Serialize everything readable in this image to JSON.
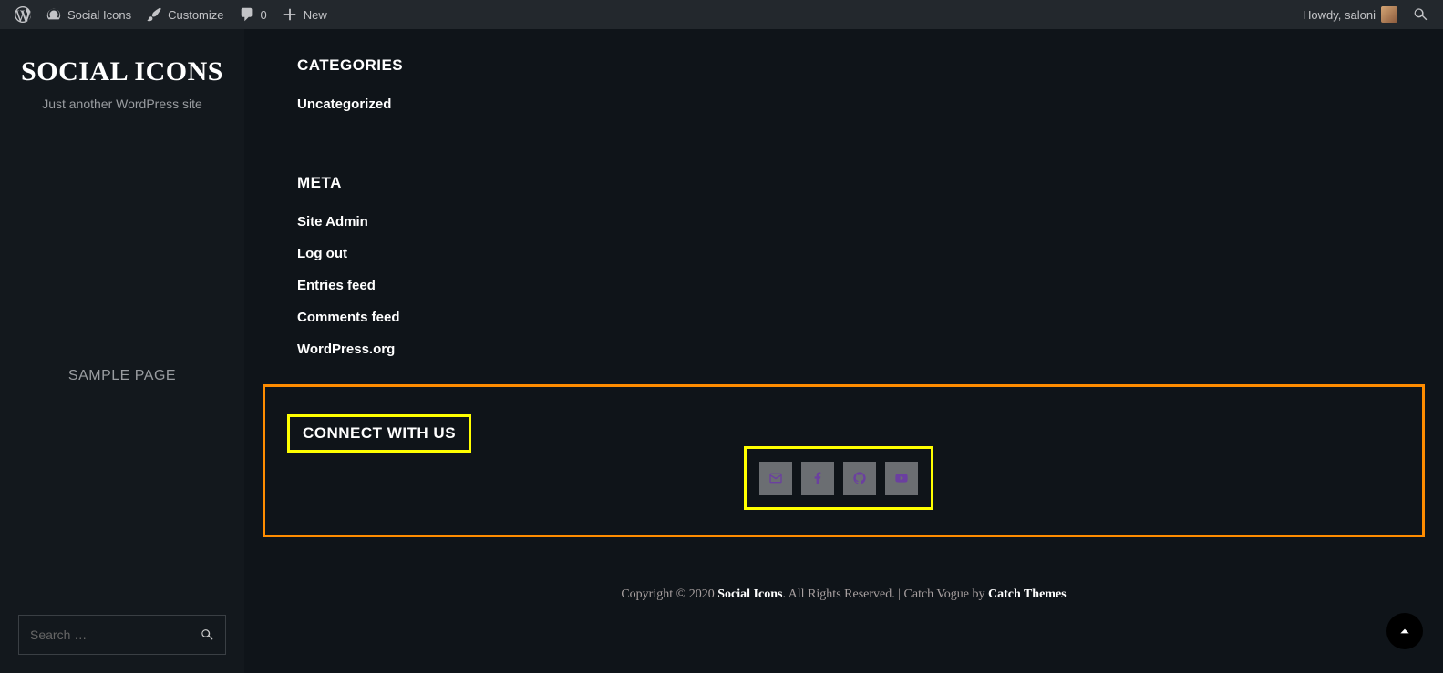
{
  "admin": {
    "siteName": "Social Icons",
    "customize": "Customize",
    "commentCount": "0",
    "new": "New",
    "howdy": "Howdy, saloni"
  },
  "sidebar": {
    "title": "SOCIAL ICONS",
    "tagline": "Just another WordPress site",
    "nav": "SAMPLE PAGE",
    "searchPlaceholder": "Search …"
  },
  "widgets": {
    "categories": {
      "title": "CATEGORIES",
      "items": [
        "Uncategorized"
      ]
    },
    "meta": {
      "title": "META",
      "items": [
        "Site Admin",
        "Log out",
        "Entries feed",
        "Comments feed",
        "WordPress.org"
      ]
    }
  },
  "connect": {
    "title": "CONNECT WITH US",
    "icons": [
      "email",
      "facebook",
      "github",
      "youtube"
    ]
  },
  "footer": {
    "copyright": "Copyright © 2020 ",
    "siteLink": "Social Icons",
    "rights": ". All Rights Reserved. | Catch Vogue by ",
    "themeLink": "Catch Themes"
  }
}
